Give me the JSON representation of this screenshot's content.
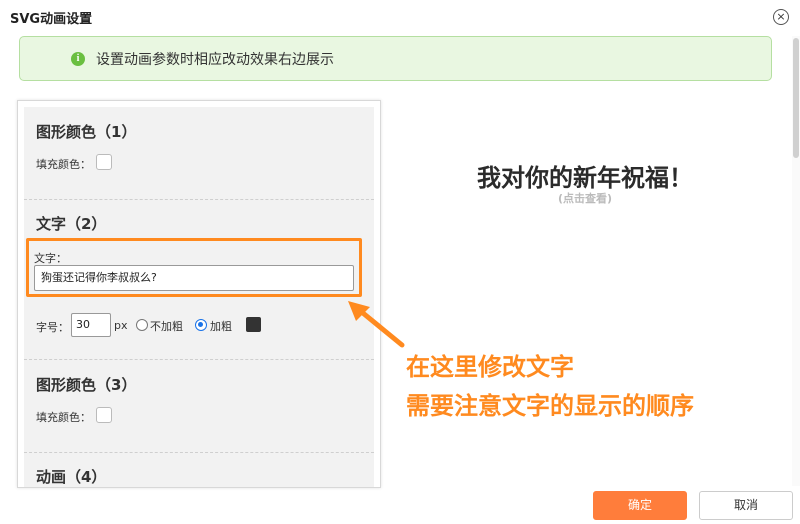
{
  "dialog": {
    "title": "SVG动画设置",
    "close_glyph": "×"
  },
  "alert": {
    "icon": "info-icon",
    "text": "设置动画参数时相应改动效果右边展示",
    "color": "#e9f7e1"
  },
  "panel": {
    "sections": [
      {
        "title": "图形颜色（1）",
        "fill_label": "填充颜色："
      },
      {
        "title": "文字（2）",
        "text_label": "文字：",
        "text_value": "狗蛋还记得你李叔叔么?",
        "size_label": "字号：",
        "size_value": "30",
        "size_unit": "px",
        "weight_options": [
          "不加粗",
          "加粗"
        ],
        "weight_selected": "加粗",
        "text_color": "#333333"
      },
      {
        "title": "图形颜色（3）",
        "fill_label": "填充颜色："
      },
      {
        "title": "动画（4）"
      }
    ]
  },
  "preview": {
    "title": "我对你的新年祝福！",
    "hint": "(点击查看)"
  },
  "annotation": {
    "line1": "在这里修改文字",
    "line2": "需要注意文字的显示的顺序",
    "color": "#ff8a1f"
  },
  "footer": {
    "ok_label": "确定",
    "cancel_label": "取消",
    "accent": "#ff7d3b"
  }
}
